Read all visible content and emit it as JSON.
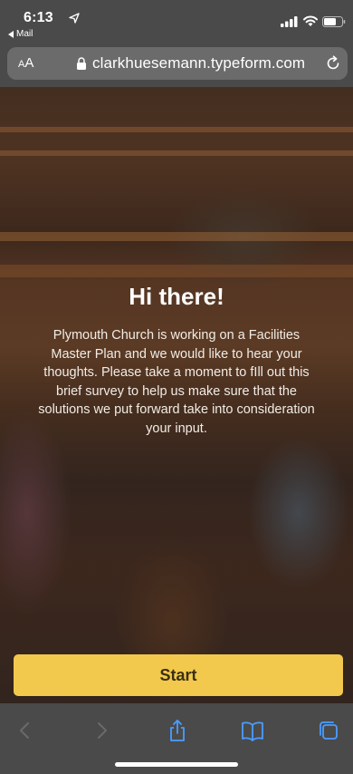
{
  "status_bar": {
    "time": "6:13",
    "back_app": "Mail"
  },
  "browser": {
    "text_size_label_small": "A",
    "text_size_label_large": "A",
    "url": "clarkhuesemann.typeform.com"
  },
  "form": {
    "title": "Hi there!",
    "description": "Plymouth Church is working on a Facilities Master Plan and we would like to hear your thoughts. Please take a moment to fIll out this brief survey to help us make sure that the solutions we put forward take into consideration your input.",
    "start_label": "Start",
    "accent_color": "#f2c94c"
  },
  "toolbar": {
    "icons": [
      "back-icon",
      "forward-icon",
      "share-icon",
      "bookmarks-icon",
      "tabs-icon"
    ],
    "icon_color": "#4a9dff"
  }
}
